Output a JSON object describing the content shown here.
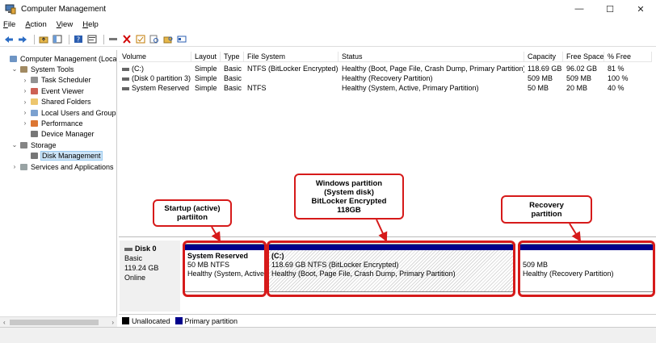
{
  "window": {
    "title": "Computer Management",
    "minimize": "—",
    "maximize": "☐",
    "close": "✕"
  },
  "menu": [
    "File",
    "Action",
    "View",
    "Help"
  ],
  "tree": [
    {
      "label": "Computer Management (Local",
      "level": 0,
      "expander": "",
      "icon": "computer-management-icon"
    },
    {
      "label": "System Tools",
      "level": 1,
      "expander": "⌄",
      "icon": "tools-icon"
    },
    {
      "label": "Task Scheduler",
      "level": 2,
      "expander": "›",
      "icon": "clock-icon"
    },
    {
      "label": "Event Viewer",
      "level": 2,
      "expander": "›",
      "icon": "event-viewer-icon"
    },
    {
      "label": "Shared Folders",
      "level": 2,
      "expander": "›",
      "icon": "shared-folder-icon"
    },
    {
      "label": "Local Users and Groups",
      "level": 2,
      "expander": "›",
      "icon": "users-icon"
    },
    {
      "label": "Performance",
      "level": 2,
      "expander": "›",
      "icon": "performance-icon"
    },
    {
      "label": "Device Manager",
      "level": 2,
      "expander": "",
      "icon": "device-manager-icon"
    },
    {
      "label": "Storage",
      "level": 1,
      "expander": "⌄",
      "icon": "storage-icon"
    },
    {
      "label": "Disk Management",
      "level": 2,
      "expander": "",
      "icon": "disk-icon",
      "selected": true
    },
    {
      "label": "Services and Applications",
      "level": 1,
      "expander": "›",
      "icon": "services-icon"
    }
  ],
  "volume_table": {
    "headers": [
      "Volume",
      "Layout",
      "Type",
      "File System",
      "Status",
      "Capacity",
      "Free Space",
      "% Free"
    ],
    "rows": [
      [
        "(C:)",
        "Simple",
        "Basic",
        "NTFS (BitLocker Encrypted)",
        "Healthy (Boot, Page File, Crash Dump, Primary Partition)",
        "118.69 GB",
        "96.02 GB",
        "81 %"
      ],
      [
        "(Disk 0 partition 3)",
        "Simple",
        "Basic",
        "",
        "Healthy (Recovery Partition)",
        "509 MB",
        "509 MB",
        "100 %"
      ],
      [
        "System Reserved",
        "Simple",
        "Basic",
        "NTFS",
        "Healthy (System, Active, Primary Partition)",
        "50 MB",
        "20 MB",
        "40 %"
      ]
    ]
  },
  "disk": {
    "name": "Disk 0",
    "type": "Basic",
    "size": "119.24 GB",
    "state": "Online",
    "partitions": [
      {
        "name": "System Reserved",
        "size": "50 MB NTFS",
        "status": "Healthy (System, Active"
      },
      {
        "name": "(C:)",
        "size": "118.69 GB NTFS (BitLocker Encrypted)",
        "status": "Healthy (Boot, Page File, Crash Dump, Primary Partition)"
      },
      {
        "name": "",
        "size": "509 MB",
        "status": "Healthy (Recovery Partition)"
      }
    ]
  },
  "legend": {
    "unallocated": "Unallocated",
    "primary": "Primary partition",
    "unallocated_color": "#000000",
    "primary_color": "#00008b"
  },
  "callouts": {
    "startup": [
      "Startup (active)",
      "partiiton"
    ],
    "windows": [
      "Windows partition",
      "(System disk)",
      "BitLocker Encrypted",
      "118GB"
    ],
    "recovery": [
      "Recovery",
      "partition"
    ],
    "accent_color": "#d61a1a"
  }
}
